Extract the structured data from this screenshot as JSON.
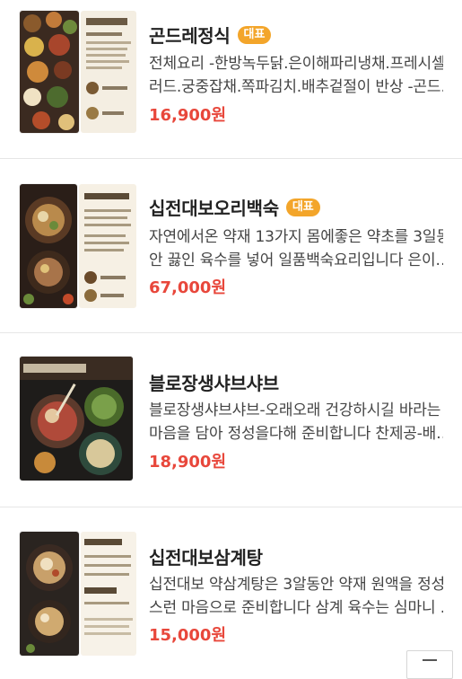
{
  "menu": {
    "items": [
      {
        "name": "곤드레정식",
        "badge": "대표",
        "desc_line1": "전체요리 -한방녹두닭.은이해파리냉채.프레시셀",
        "desc_line2": "러드.궁중잡채.쪽파김치.배추겉절이 반상 -곤드…",
        "price": "16,900원"
      },
      {
        "name": "십전대보오리백숙",
        "badge": "대표",
        "desc_line1": "자연에서온 약재 13가지 몸에좋은 약초를 3일동",
        "desc_line2": "안 끓인 육수를 넣어 일품백숙요리입니다 은이…",
        "price": "67,000원"
      },
      {
        "name": "블로장생샤브샤브",
        "badge": "",
        "desc_line1": "블로장생샤브샤브-오래오래 건강하시길 바라는",
        "desc_line2": "마음을 담아 정성을다해 준비합니다 찬제공-배…",
        "price": "18,900원"
      },
      {
        "name": "십전대보삼계탕",
        "badge": "",
        "desc_line1": "십전대보 약삼계탕은 3알동안 약재 원액을 정성",
        "desc_line2": "스런 마음으로 준비합니다 삼계 육수는 심마니 …",
        "price": "15,000원"
      }
    ]
  },
  "colors": {
    "price": "#e8473b",
    "badge": "#f3a52a"
  },
  "icons": {
    "scroll_top": "scroll-to-top-icon"
  }
}
